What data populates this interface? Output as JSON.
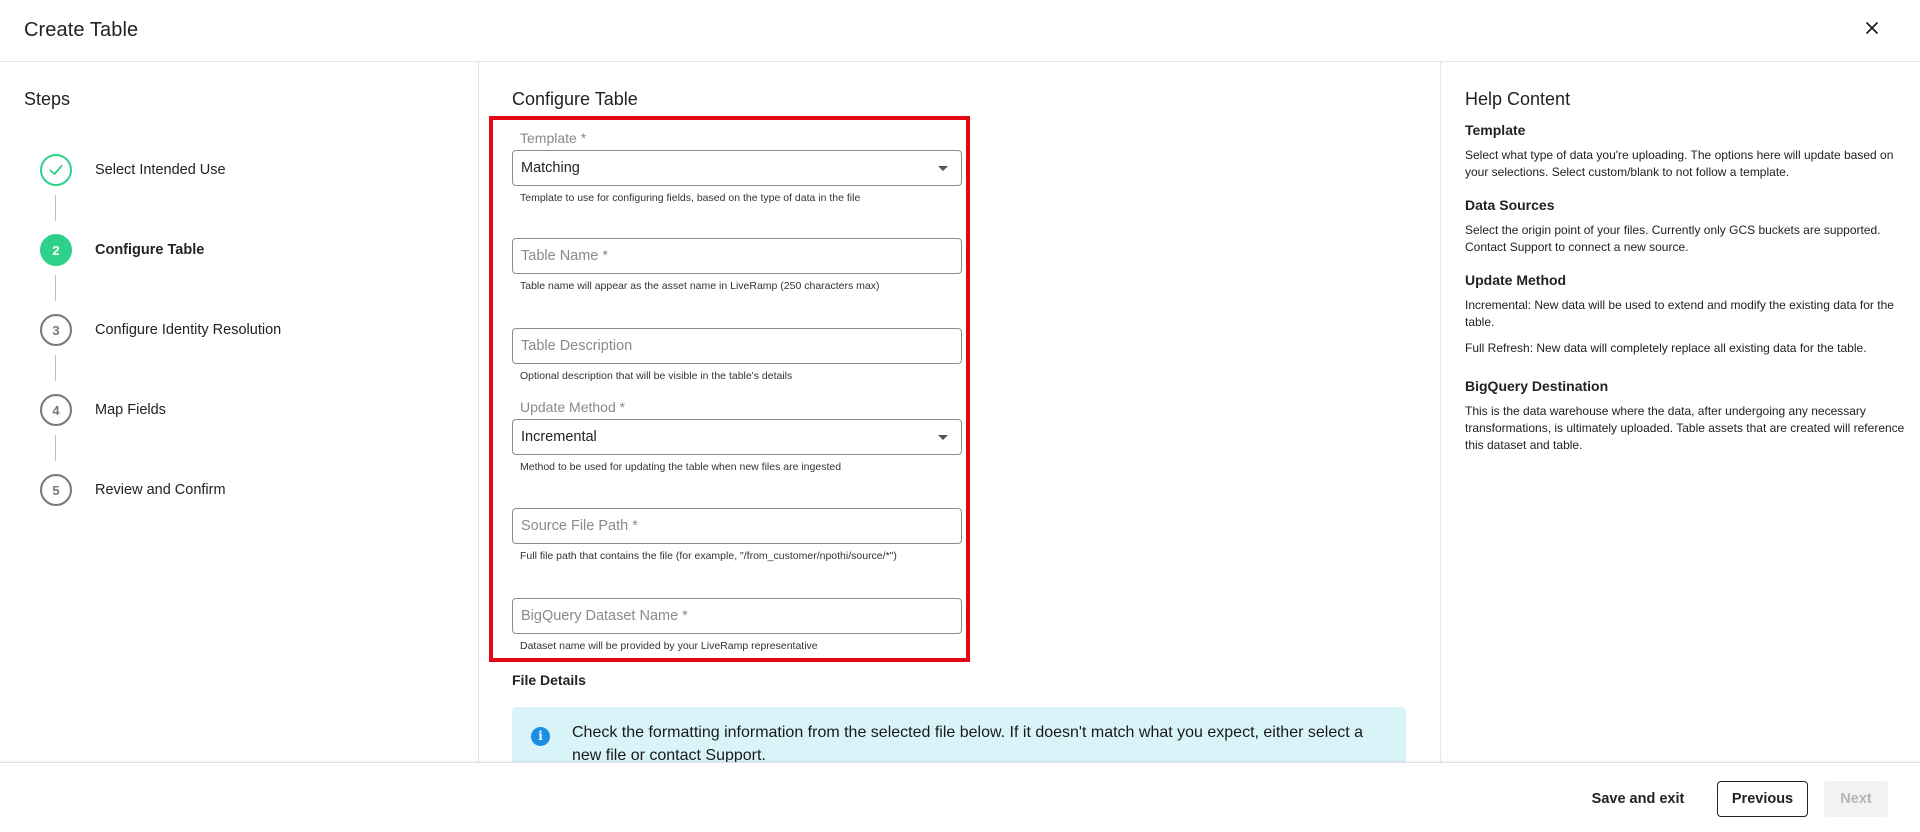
{
  "header": {
    "title": "Create Table",
    "close_icon": "close-icon"
  },
  "steps": {
    "title": "Steps",
    "items": [
      {
        "number": "",
        "label": "Select Intended Use",
        "state": "completed",
        "icon": "check-icon"
      },
      {
        "number": "2",
        "label": "Configure Table",
        "state": "active"
      },
      {
        "number": "3",
        "label": "Configure Identity Resolution",
        "state": "pending"
      },
      {
        "number": "4",
        "label": "Map Fields",
        "state": "pending"
      },
      {
        "number": "5",
        "label": "Review and Confirm",
        "state": "pending"
      }
    ]
  },
  "main": {
    "title": "Configure Table",
    "fields": {
      "template": {
        "label": "Template *",
        "value": "Matching",
        "helper": "Template to use for configuring fields, based on the type of data in the file"
      },
      "table_name": {
        "placeholder": "Table Name *",
        "value": "",
        "helper": "Table name will appear as the asset name in LiveRamp (250 characters max)"
      },
      "table_description": {
        "placeholder": "Table Description",
        "value": "",
        "helper": "Optional description that will be visible in the table's details"
      },
      "update_method": {
        "label": "Update Method *",
        "value": "Incremental",
        "helper": "Method to be used for updating the table when new files are ingested"
      },
      "source_file_path": {
        "placeholder": "Source File Path *",
        "value": "",
        "helper": "Full file path that contains the file (for example, \"/from_customer/npothi/source/*\")"
      },
      "bigquery_dataset": {
        "placeholder": "BigQuery Dataset Name *",
        "value": "",
        "helper": "Dataset name will be provided by your LiveRamp representative"
      }
    },
    "file_details": {
      "title": "File Details",
      "info": "Check the formatting information from the selected file below. If it doesn't match what you expect, either select a new file or contact Support."
    },
    "highlight_color": "#e30613"
  },
  "help": {
    "title": "Help Content",
    "sections": [
      {
        "heading": "Template",
        "paragraphs": [
          "Select what type of data you're uploading. The options here will update based on your selections. Select custom/blank to not follow a template."
        ]
      },
      {
        "heading": "Data Sources",
        "paragraphs": [
          "Select the origin point of your files. Currently only GCS buckets are supported. Contact Support to connect a new source."
        ]
      },
      {
        "heading": "Update Method",
        "paragraphs": [
          "Incremental: New data will be used to extend and modify the existing data for the table.",
          "Full Refresh: New data will completely replace all existing data for the table."
        ]
      },
      {
        "heading": "BigQuery Destination",
        "paragraphs": [
          "This is the data warehouse where the data, after undergoing any necessary transformations, is ultimately uploaded. Table assets that are created will reference this dataset and table."
        ]
      }
    ]
  },
  "footer": {
    "save_label": "Save and exit",
    "previous_label": "Previous",
    "next_label": "Next",
    "next_disabled": true
  },
  "colors": {
    "accent_green": "#2fd08a",
    "info_blue": "#1a8fe3",
    "info_bg": "#d8f4f9"
  }
}
